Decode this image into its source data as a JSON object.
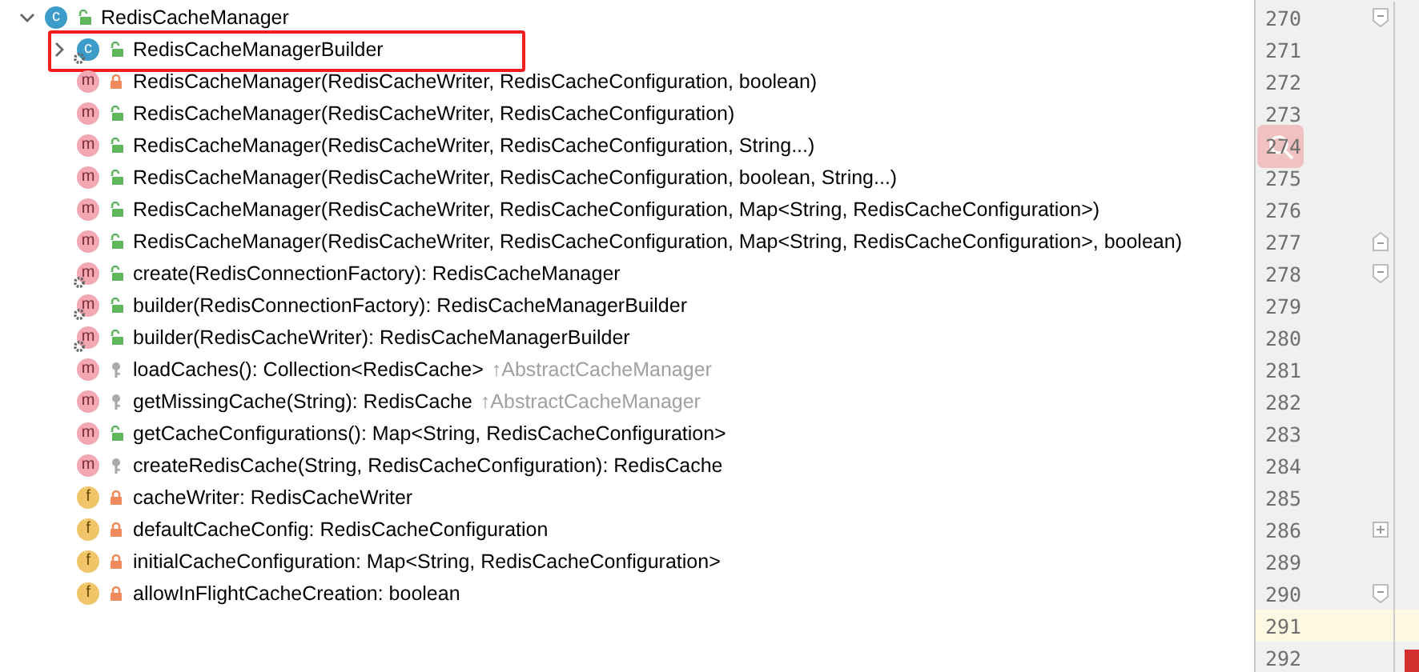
{
  "structure": [
    {
      "name": "RedisCacheManager",
      "kind": "class",
      "icon_letter": "c",
      "private": false,
      "protected": false,
      "static": false,
      "expanded": true,
      "children": [
        {
          "name": "RedisCacheManagerBuilder",
          "kind": "class",
          "icon_letter": "c",
          "private": false,
          "protected": false,
          "static": true,
          "expanded": false,
          "highlighted": true
        },
        {
          "name": "RedisCacheManager(RedisCacheWriter, RedisCacheConfiguration, boolean)",
          "kind": "method",
          "icon_letter": "m",
          "private": true,
          "protected": false,
          "static": false
        },
        {
          "name": "RedisCacheManager(RedisCacheWriter, RedisCacheConfiguration)",
          "kind": "method",
          "icon_letter": "m",
          "private": false,
          "protected": false,
          "static": false
        },
        {
          "name": "RedisCacheManager(RedisCacheWriter, RedisCacheConfiguration, String...)",
          "kind": "method",
          "icon_letter": "m",
          "private": false,
          "protected": false,
          "static": false
        },
        {
          "name": "RedisCacheManager(RedisCacheWriter, RedisCacheConfiguration, boolean, String...)",
          "kind": "method",
          "icon_letter": "m",
          "private": false,
          "protected": false,
          "static": false
        },
        {
          "name": "RedisCacheManager(RedisCacheWriter, RedisCacheConfiguration, Map<String, RedisCacheConfiguration>)",
          "kind": "method",
          "icon_letter": "m",
          "private": false,
          "protected": false,
          "static": false
        },
        {
          "name": "RedisCacheManager(RedisCacheWriter, RedisCacheConfiguration, Map<String, RedisCacheConfiguration>, boolean)",
          "kind": "method",
          "icon_letter": "m",
          "private": false,
          "protected": false,
          "static": false
        },
        {
          "name": "create(RedisConnectionFactory): RedisCacheManager",
          "kind": "method",
          "icon_letter": "m",
          "private": false,
          "protected": false,
          "static": true
        },
        {
          "name": "builder(RedisConnectionFactory): RedisCacheManagerBuilder",
          "kind": "method",
          "icon_letter": "m",
          "private": false,
          "protected": false,
          "static": true
        },
        {
          "name": "builder(RedisCacheWriter): RedisCacheManagerBuilder",
          "kind": "method",
          "icon_letter": "m",
          "private": false,
          "protected": false,
          "static": true
        },
        {
          "name": "loadCaches(): Collection<RedisCache>",
          "kind": "method",
          "icon_letter": "m",
          "private": false,
          "protected": true,
          "static": false,
          "inherited_from": "↑AbstractCacheManager"
        },
        {
          "name": "getMissingCache(String): RedisCache",
          "kind": "method",
          "icon_letter": "m",
          "private": false,
          "protected": true,
          "static": false,
          "inherited_from": "↑AbstractCacheManager"
        },
        {
          "name": "getCacheConfigurations(): Map<String, RedisCacheConfiguration>",
          "kind": "method",
          "icon_letter": "m",
          "private": false,
          "protected": false,
          "static": false
        },
        {
          "name": "createRedisCache(String, RedisCacheConfiguration): RedisCache",
          "kind": "method",
          "icon_letter": "m",
          "private": false,
          "protected": true,
          "static": false
        },
        {
          "name": "cacheWriter: RedisCacheWriter",
          "kind": "field",
          "icon_letter": "f",
          "private": true,
          "protected": false,
          "static": false
        },
        {
          "name": "defaultCacheConfig: RedisCacheConfiguration",
          "kind": "field",
          "icon_letter": "f",
          "private": true,
          "protected": false,
          "static": false
        },
        {
          "name": "initialCacheConfiguration: Map<String, RedisCacheConfiguration>",
          "kind": "field",
          "icon_letter": "f",
          "private": true,
          "protected": false,
          "static": false
        },
        {
          "name": "allowInFlightCacheCreation: boolean",
          "kind": "field",
          "icon_letter": "f",
          "private": true,
          "protected": false,
          "static": false
        }
      ]
    }
  ],
  "gutter": [
    {
      "number": "270",
      "kind": "fold",
      "expanded": true
    },
    {
      "number": "271",
      "kind": "plain"
    },
    {
      "number": "272",
      "kind": "plain"
    },
    {
      "number": "273",
      "kind": "plain"
    },
    {
      "number": "274",
      "kind": "plain"
    },
    {
      "number": "275",
      "kind": "plain"
    },
    {
      "number": "276",
      "kind": "plain"
    },
    {
      "number": "277",
      "kind": "foldend"
    },
    {
      "number": "278",
      "kind": "fold",
      "expanded": true
    },
    {
      "number": "279",
      "kind": "plain"
    },
    {
      "number": "280",
      "kind": "plain"
    },
    {
      "number": "281",
      "kind": "plain"
    },
    {
      "number": "282",
      "kind": "plain"
    },
    {
      "number": "283",
      "kind": "plain"
    },
    {
      "number": "284",
      "kind": "plain"
    },
    {
      "number": "285",
      "kind": "plain"
    },
    {
      "number": "286",
      "kind": "fold",
      "expanded": false
    },
    {
      "number": "289",
      "kind": "plain"
    },
    {
      "number": "290",
      "kind": "fold",
      "expanded": true
    },
    {
      "number": "291",
      "kind": "plain",
      "current": true
    },
    {
      "number": "292",
      "kind": "plain"
    }
  ]
}
